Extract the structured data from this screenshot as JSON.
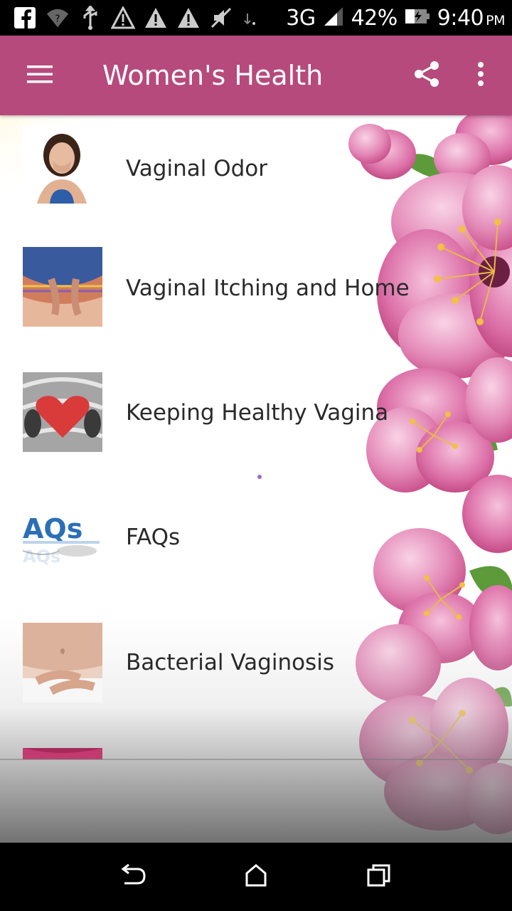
{
  "status_bar": {
    "icons": [
      "facebook-icon",
      "wifi-question-icon",
      "usb-icon",
      "warning-icon",
      "warning-icon",
      "warning-icon",
      "mute-icon",
      "data-arrows-icon"
    ],
    "network": "3G",
    "battery": "42%",
    "time": "9:40",
    "time_suffix": "PM"
  },
  "app_bar": {
    "title": "Women's Health",
    "color": "#b64a7c",
    "icons": [
      "menu-icon",
      "share-icon",
      "overflow-menu-icon"
    ]
  },
  "list": {
    "items": [
      {
        "label": "Vaginal Odor",
        "thumb": "woman-covering-mouth"
      },
      {
        "label": "Vaginal Itching and Home",
        "thumb": "hands-on-skirt"
      },
      {
        "label": "Keeping Healthy Vagina",
        "thumb": "red-heart"
      },
      {
        "label": "FAQs",
        "thumb": "faqs-text"
      },
      {
        "label": "Bacterial Vaginosis",
        "thumb": "hands-on-belly"
      },
      {
        "label": "",
        "thumb": "pink-partial"
      }
    ]
  },
  "nav_bar": {
    "icons": [
      "back-icon",
      "home-icon",
      "recents-icon"
    ]
  }
}
